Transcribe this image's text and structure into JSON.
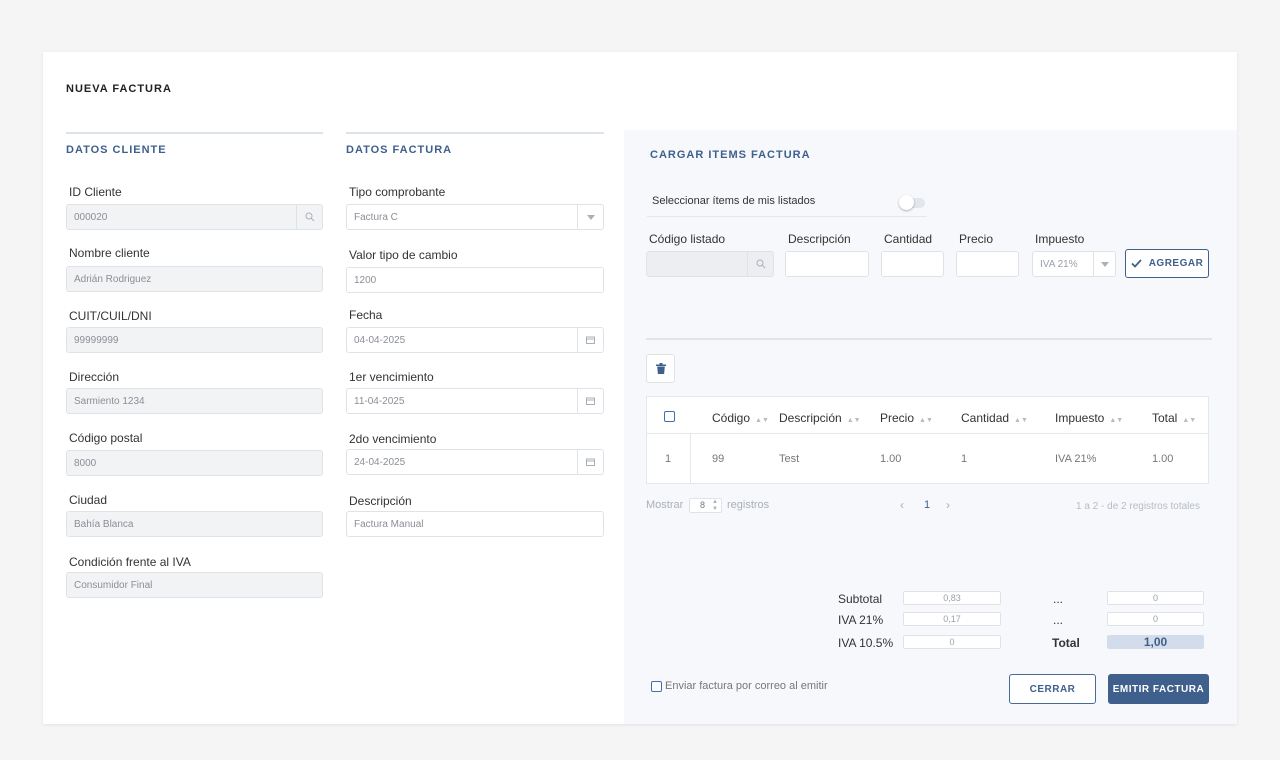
{
  "page": {
    "title": "NUEVA FACTURA"
  },
  "cliente": {
    "section_title": "DATOS CLIENTE",
    "fields": [
      {
        "label": "ID Cliente",
        "value": "000020"
      },
      {
        "label": "Nombre cliente",
        "value": "Adrián Rodriguez"
      },
      {
        "label": "CUIT/CUIL/DNI",
        "value": "99999999"
      },
      {
        "label": "Dirección",
        "value": "Sarmiento 1234"
      },
      {
        "label": "Código postal",
        "value": "8000"
      },
      {
        "label": "Ciudad",
        "value": "Bahía Blanca"
      },
      {
        "label": "Condición frente al IVA",
        "value": "Consumidor Final"
      }
    ]
  },
  "factura": {
    "section_title": "DATOS FACTURA",
    "fields": [
      {
        "label": "Tipo comprobante",
        "value": "Factura C"
      },
      {
        "label": "Valor tipo de cambio",
        "value": "1200"
      },
      {
        "label": "Fecha",
        "value": "04-04-2025"
      },
      {
        "label": "1er vencimiento",
        "value": "11-04-2025"
      },
      {
        "label": "2do vencimiento",
        "value": "24-04-2025"
      },
      {
        "label": "Descripción",
        "value": "Factura Manual"
      }
    ]
  },
  "items": {
    "section_title": "CARGAR ITEMS FACTURA",
    "toggle_label": "Seleccionar ítems de mis listados",
    "labels": {
      "codigo": "Código listado",
      "descripcion": "Descripción",
      "cantidad": "Cantidad",
      "precio": "Precio",
      "impuesto": "Impuesto"
    },
    "impuesto_value": "IVA 21%",
    "add_button": "AGREGAR"
  },
  "table": {
    "headers": [
      "Código",
      "Descripción",
      "Precio",
      "Cantidad",
      "Impuesto",
      "Total"
    ],
    "rows": [
      {
        "num": "1",
        "codigo": "99",
        "descripcion": "Test",
        "precio": "1.00",
        "cantidad": "1",
        "impuesto": "IVA 21%",
        "total": "1.00"
      }
    ],
    "show_label": "Mostrar",
    "page_size": "8",
    "records_label": "registros",
    "page": "1",
    "summary": "1 a 2 - de 2 registros totales"
  },
  "totals": {
    "subtotal_label": "Subtotal",
    "subtotal": "0,83",
    "iva21_label": "IVA 21%",
    "iva21": "0,17",
    "iva105_label": "IVA 10.5%",
    "iva105": "0",
    "other1_label": "...",
    "other1": "0",
    "other2_label": "...",
    "other2": "0",
    "total_label": "Total",
    "total": "1,00"
  },
  "footer": {
    "email_label": "Enviar factura por correo al emitir",
    "close_button": "CERRAR",
    "emit_button": "EMITIR FACTURA"
  },
  "colors": {
    "accent": "#3f5f8c",
    "panel": "#f6f8fb"
  }
}
